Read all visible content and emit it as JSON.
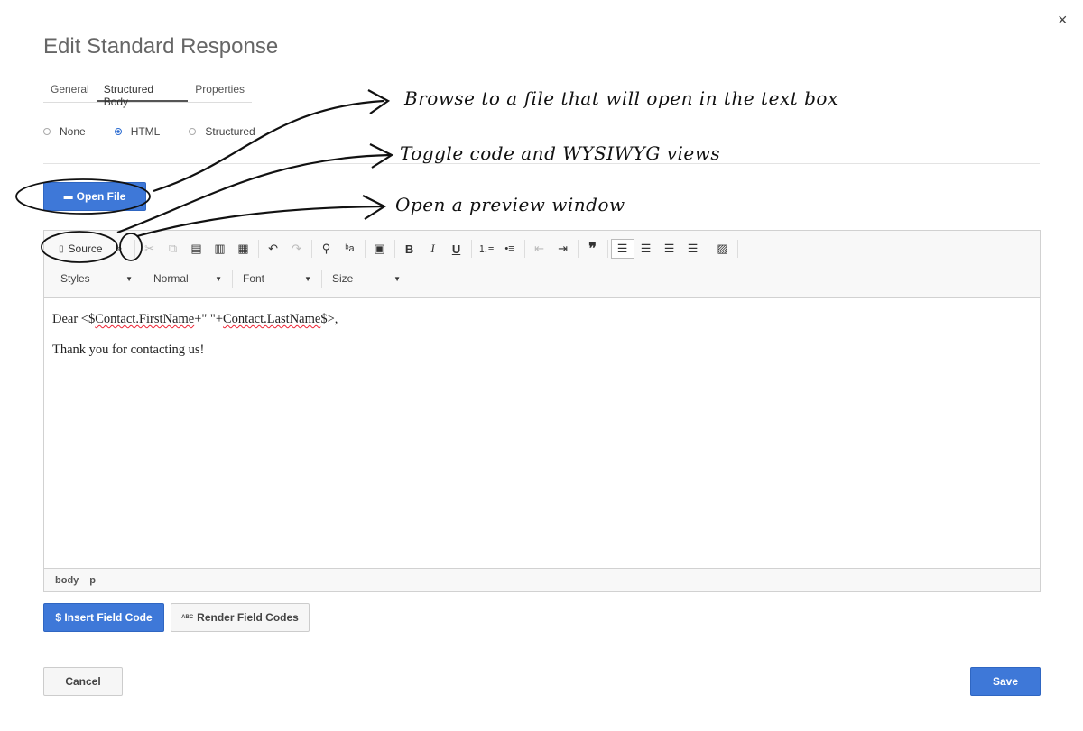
{
  "dialog": {
    "title": "Edit Standard Response",
    "close_icon": "×"
  },
  "tabs": [
    {
      "label": "General"
    },
    {
      "label": "Structured Body",
      "active": true
    },
    {
      "label": "Properties"
    }
  ],
  "format_options": {
    "selected": "HTML",
    "items": [
      {
        "label": "None"
      },
      {
        "label": "HTML"
      },
      {
        "label": "Structured"
      }
    ]
  },
  "open_file_button": {
    "label": "Open File"
  },
  "editor": {
    "toolbar": {
      "source_label": "Source",
      "styles": "Styles",
      "format": "Normal",
      "font": "Font",
      "size": "Size"
    },
    "content": {
      "line1_prefix": "Dear <$",
      "line1_field1": "Contact.FirstName",
      "line1_mid": "+\" \"+",
      "line1_field2": "Contact.LastName",
      "line1_suffix": "$>,",
      "line2": "Thank you for contacting us!"
    },
    "status_path": [
      "body",
      "p"
    ]
  },
  "insert_field_code_button": {
    "label": "$ Insert Field Code"
  },
  "render_field_codes_button": {
    "label": "Render Field Codes",
    "icon_text": "ABC"
  },
  "cancel_button": {
    "label": "Cancel"
  },
  "save_button": {
    "label": "Save"
  },
  "annotations": {
    "open_file": "Browse to a file that will open in the text box",
    "source": "Toggle code and WYSIWYG views",
    "preview": "Open a preview window"
  },
  "colors": {
    "accent": "#3e78d8",
    "text": "#444444"
  }
}
